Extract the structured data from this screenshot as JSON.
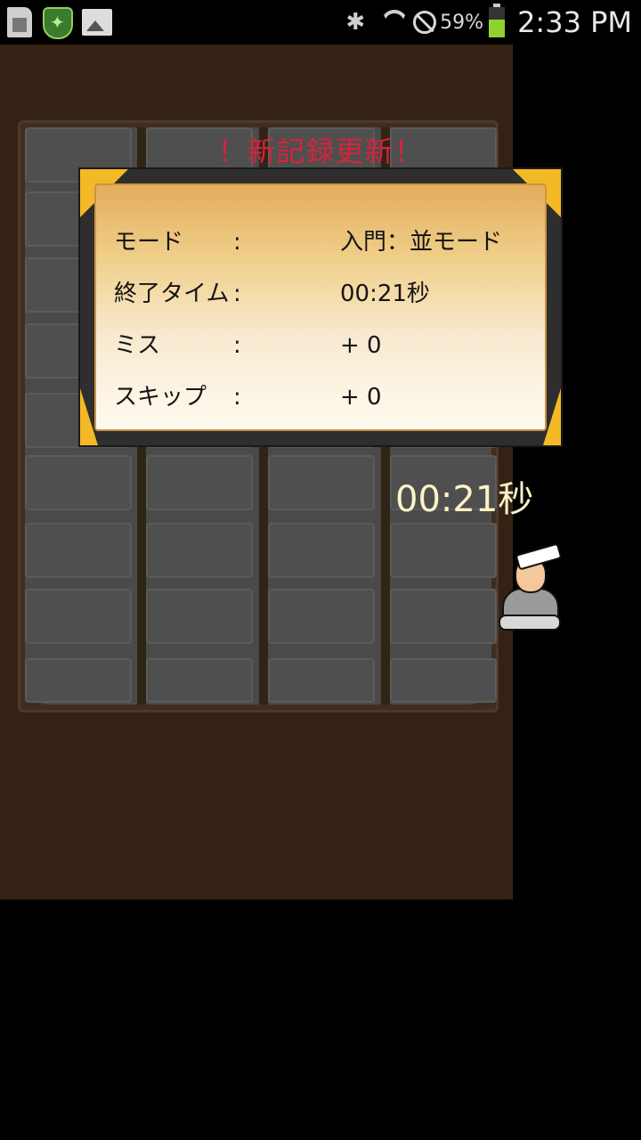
{
  "status_bar": {
    "icons": [
      "sim-card-icon",
      "shield-app-icon",
      "image-icon",
      "bluetooth-icon",
      "wifi-icon",
      "no-disturb-icon",
      "battery-icon"
    ],
    "battery_percent": "59%",
    "battery_level": 0.59,
    "time": "2:33 PM"
  },
  "game": {
    "new_record_banner": "！新記録更新！",
    "result": {
      "rows": [
        {
          "label": "モード",
          "colon": ":",
          "value": "入門：並モード"
        },
        {
          "label": "終了タイム",
          "colon": ":",
          "value": "00:21秒"
        },
        {
          "label": "ミス",
          "colon": ":",
          "value": "+ 0"
        },
        {
          "label": "スキップ",
          "colon": ":",
          "value": "+ 0"
        }
      ]
    },
    "timer": "00:21秒",
    "character": "samurai-character",
    "colors": {
      "banner": "#d6233a",
      "timer": "#fff2c8",
      "frame_gold": "#f3b926",
      "background": "#352214"
    }
  }
}
